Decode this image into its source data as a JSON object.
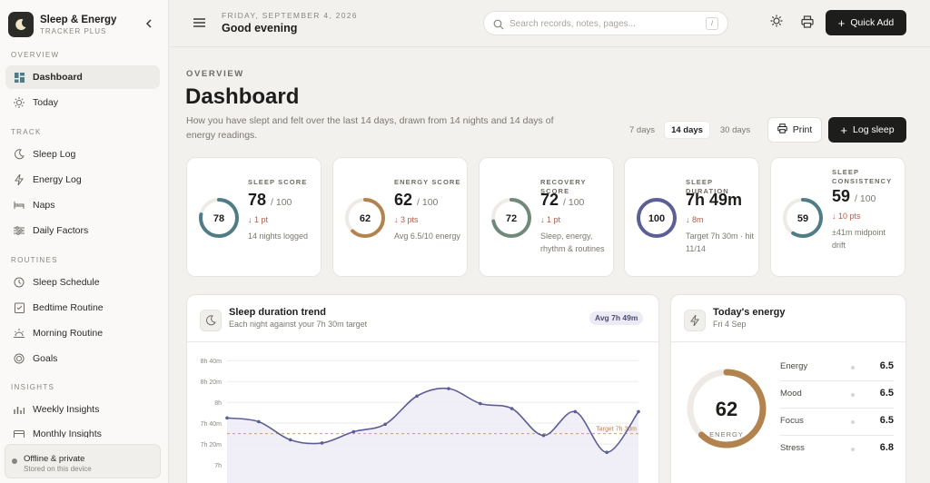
{
  "app": {
    "name": "Sleep & Energy",
    "sub": "TRACKER PLUS"
  },
  "sidebar": {
    "sections": [
      {
        "label": "OVERVIEW"
      },
      {
        "label": "TRACK"
      },
      {
        "label": "ROUTINES"
      },
      {
        "label": "INSIGHTS"
      }
    ],
    "items": [
      {
        "label": "Dashboard",
        "icon": "grid-icon"
      },
      {
        "label": "Today",
        "icon": "sun-icon"
      },
      {
        "label": "Sleep Log",
        "icon": "moon-icon"
      },
      {
        "label": "Energy Log",
        "icon": "bolt-icon"
      },
      {
        "label": "Naps",
        "icon": "bed-icon"
      },
      {
        "label": "Daily Factors",
        "icon": "sliders-icon"
      },
      {
        "label": "Sleep Schedule",
        "icon": "clock-icon"
      },
      {
        "label": "Bedtime Routine",
        "icon": "checklist-icon"
      },
      {
        "label": "Morning Routine",
        "icon": "sunrise-icon"
      },
      {
        "label": "Goals",
        "icon": "target-icon"
      },
      {
        "label": "Weekly Insights",
        "icon": "chart-icon"
      },
      {
        "label": "Monthly Insights",
        "icon": "calendar-icon"
      }
    ],
    "status": {
      "title": "Offline & private",
      "sub": "Stored on this device"
    }
  },
  "header": {
    "date": "FRIDAY, SEPTEMBER 4, 2026",
    "greeting": "Good evening",
    "search_placeholder": "Search records, notes, pages...",
    "search_shortcut": "/",
    "quick_add": "Quick Add"
  },
  "main": {
    "overline": "OVERVIEW",
    "title": "Dashboard",
    "description": "How you have slept and felt over the last 14 days, drawn from 14 nights and 14 days of energy readings.",
    "ranges": [
      "7 days",
      "14 days",
      "30 days"
    ],
    "active_range": "14 days",
    "print": "Print",
    "log_sleep": "Log sleep"
  },
  "stats": [
    {
      "label": "SLEEP SCORE",
      "value": "78",
      "max": "/ 100",
      "ring": "78",
      "fraction": 0.78,
      "color": "#4f7c86",
      "delta": "↓ 1 pt",
      "note": "14 nights logged"
    },
    {
      "label": "ENERGY SCORE",
      "value": "62",
      "max": "/ 100",
      "ring": "62",
      "fraction": 0.62,
      "color": "#b3834f",
      "delta": "↓ 3 pts",
      "note": "Avg 6.5/10 energy"
    },
    {
      "label": "RECOVERY SCORE",
      "value": "72",
      "max": "/ 100",
      "ring": "72",
      "fraction": 0.72,
      "color": "#6f8a7a",
      "delta": "↓ 1 pt",
      "note": "Sleep, energy, rhythm & routines"
    },
    {
      "label": "SLEEP DURATION",
      "value": "7h 49m",
      "max": "",
      "ring": "100",
      "fraction": 1.0,
      "color": "#5c5e96",
      "delta": "↓ 8m",
      "note": "Target 7h 30m · hit 11/14"
    },
    {
      "label": "SLEEP CONSISTENCY",
      "value": "59",
      "max": "/ 100",
      "ring": "59",
      "fraction": 0.59,
      "color": "#4f7c86",
      "delta": "↓ 10 pts",
      "note": "±41m midpoint drift"
    }
  ],
  "sleep_panel": {
    "title": "Sleep duration trend",
    "sub": "Each night against your 7h 30m target",
    "badge": "Avg 7h 49m",
    "target_label": "Target 7h 30m"
  },
  "energy_panel": {
    "title": "Today's energy",
    "sub": "Fri 4 Sep",
    "score": "62",
    "score_fraction": 0.62,
    "score_label": "ENERGY",
    "metrics": [
      {
        "name": "Energy",
        "value": "6.5"
      },
      {
        "name": "Mood",
        "value": "6.5"
      },
      {
        "name": "Focus",
        "value": "6.5"
      },
      {
        "name": "Stress",
        "value": "6.8"
      }
    ]
  },
  "chart_data": {
    "type": "line",
    "title": "Sleep duration trend",
    "x": [
      1,
      2,
      3,
      4,
      5,
      6,
      7,
      8,
      9,
      10,
      11,
      12,
      13,
      14
    ],
    "series": [
      {
        "name": "",
        "values": [
          7.75,
          7.69,
          7.4,
          7.35,
          7.53,
          7.65,
          8.1,
          8.22,
          7.98,
          7.9,
          7.47,
          7.85,
          7.2,
          7.85
        ]
      }
    ],
    "y_ticks": [
      "8h 40m",
      "8h 20m",
      "8h",
      "7h 40m",
      "7h 20m",
      "7h"
    ],
    "ylim": [
      7.0,
      8.67
    ],
    "target": 7.5,
    "grid": true
  }
}
